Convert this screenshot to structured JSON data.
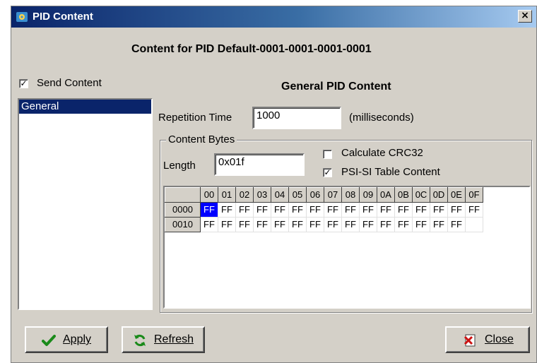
{
  "window": {
    "title": "PID Content",
    "close_glyph": "×",
    "header": "Content for PID Default-0001-0001-0001-0001"
  },
  "send_content": {
    "label": "Send Content",
    "checked": true
  },
  "list": {
    "items": [
      "General"
    ],
    "selected": "General"
  },
  "section_title": "General PID Content",
  "repetition": {
    "label": "Repetition Time",
    "value": "1000",
    "unit": "(milliseconds)"
  },
  "content_bytes": {
    "legend": "Content Bytes",
    "length_label": "Length",
    "length_value": "0x01f",
    "crc_label": "Calculate CRC32",
    "crc_checked": false,
    "psi_label": "PSI-SI Table Content",
    "psi_checked": true
  },
  "hex_grid": {
    "columns": [
      "00",
      "01",
      "02",
      "03",
      "04",
      "05",
      "06",
      "07",
      "08",
      "09",
      "0A",
      "0B",
      "0C",
      "0D",
      "0E",
      "0F"
    ],
    "rows": [
      {
        "label": "0000",
        "cells": [
          "FF",
          "FF",
          "FF",
          "FF",
          "FF",
          "FF",
          "FF",
          "FF",
          "FF",
          "FF",
          "FF",
          "FF",
          "FF",
          "FF",
          "FF",
          "FF"
        ]
      },
      {
        "label": "0010",
        "cells": [
          "FF",
          "FF",
          "FF",
          "FF",
          "FF",
          "FF",
          "FF",
          "FF",
          "FF",
          "FF",
          "FF",
          "FF",
          "FF",
          "FF",
          "FF",
          ""
        ]
      }
    ],
    "selected_cell": "0000-00"
  },
  "buttons": {
    "apply": "Apply",
    "refresh": "Refresh",
    "close": "Close"
  },
  "icons": {
    "title": "gear-network-icon",
    "apply": "checkmark-icon",
    "refresh": "refresh-icon",
    "close": "close-document-icon"
  },
  "colors": {
    "titlebar": "#0a246a",
    "selection": "#0a246a",
    "cell_selected": "#0000ff",
    "apply_check": "#1a8a1a",
    "refresh_arrows": "#1a8a1a"
  }
}
